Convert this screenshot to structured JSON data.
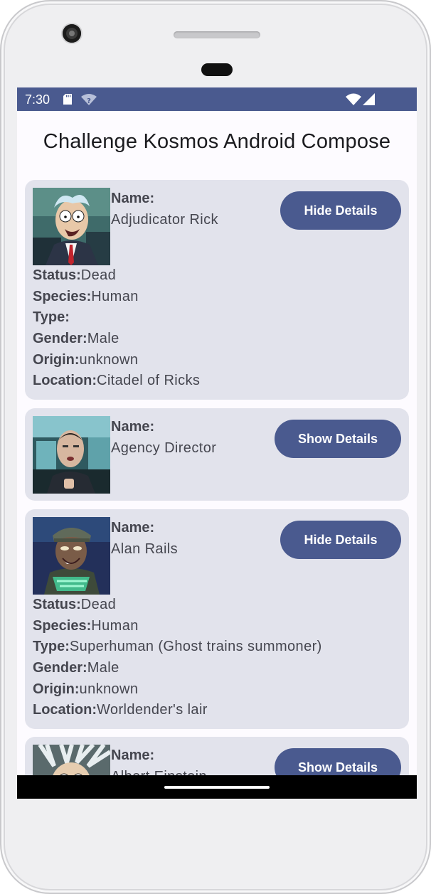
{
  "status_bar": {
    "time": "7:30",
    "wifi_question": "?"
  },
  "app_title": "Challenge Kosmos Android Compose",
  "labels": {
    "name": "Name:",
    "status": "Status:",
    "species": "Species:",
    "type": "Type:",
    "gender": "Gender:",
    "origin": "Origin:",
    "location": "Location:"
  },
  "characters": [
    {
      "name": "Adjudicator Rick",
      "button_label": "Hide Details",
      "expanded": true,
      "status": "Dead",
      "species": "Human",
      "type": "",
      "gender": "Male",
      "origin": "unknown",
      "location": "Citadel of Ricks"
    },
    {
      "name": "Agency Director",
      "button_label": "Show Details",
      "expanded": false
    },
    {
      "name": "Alan Rails",
      "button_label": "Hide Details",
      "expanded": true,
      "status": "Dead",
      "species": "Human",
      "type": "Superhuman (Ghost trains summoner)",
      "gender": "Male",
      "origin": "unknown",
      "location": "Worldender's lair"
    },
    {
      "name": "Albert Einstein",
      "button_label": "Show Details",
      "expanded": false
    }
  ],
  "colors": {
    "primary": "#4a5a8f",
    "card_background": "#e2e3ec",
    "text": "#45464f",
    "status_bar": "#4a5a8f"
  }
}
